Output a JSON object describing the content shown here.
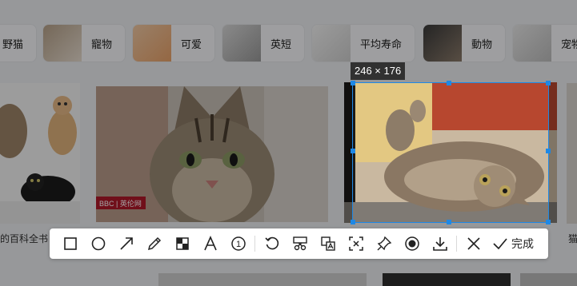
{
  "categories": [
    {
      "label": "野猫"
    },
    {
      "label": "寵物"
    },
    {
      "label": "可爱"
    },
    {
      "label": "英短"
    },
    {
      "label": "平均寿命"
    },
    {
      "label": "動物"
    },
    {
      "label": "宠物"
    }
  ],
  "page_text": {
    "left_caption": "的百科全书",
    "right_caption": "猫"
  },
  "watermark": {
    "text": "BBC | 英伦网"
  },
  "selection": {
    "size_label": "246 × 176"
  },
  "toolbar": {
    "tools": [
      {
        "name": "rectangle-tool"
      },
      {
        "name": "ellipse-tool"
      },
      {
        "name": "arrow-tool"
      },
      {
        "name": "pen-tool"
      },
      {
        "name": "mosaic-tool"
      },
      {
        "name": "text-tool"
      },
      {
        "name": "number-marker-tool",
        "glyph": "1"
      },
      {
        "name": "undo-tool"
      },
      {
        "name": "long-screenshot-tool"
      },
      {
        "name": "translate-tool"
      },
      {
        "name": "ocr-tool"
      },
      {
        "name": "pin-tool"
      },
      {
        "name": "record-tool"
      },
      {
        "name": "save-tool"
      },
      {
        "name": "cancel-tool"
      }
    ],
    "done_label": "完成"
  },
  "colors": {
    "accent": "#1e88e5",
    "overlay": "rgba(0,0,0,0.36)"
  }
}
